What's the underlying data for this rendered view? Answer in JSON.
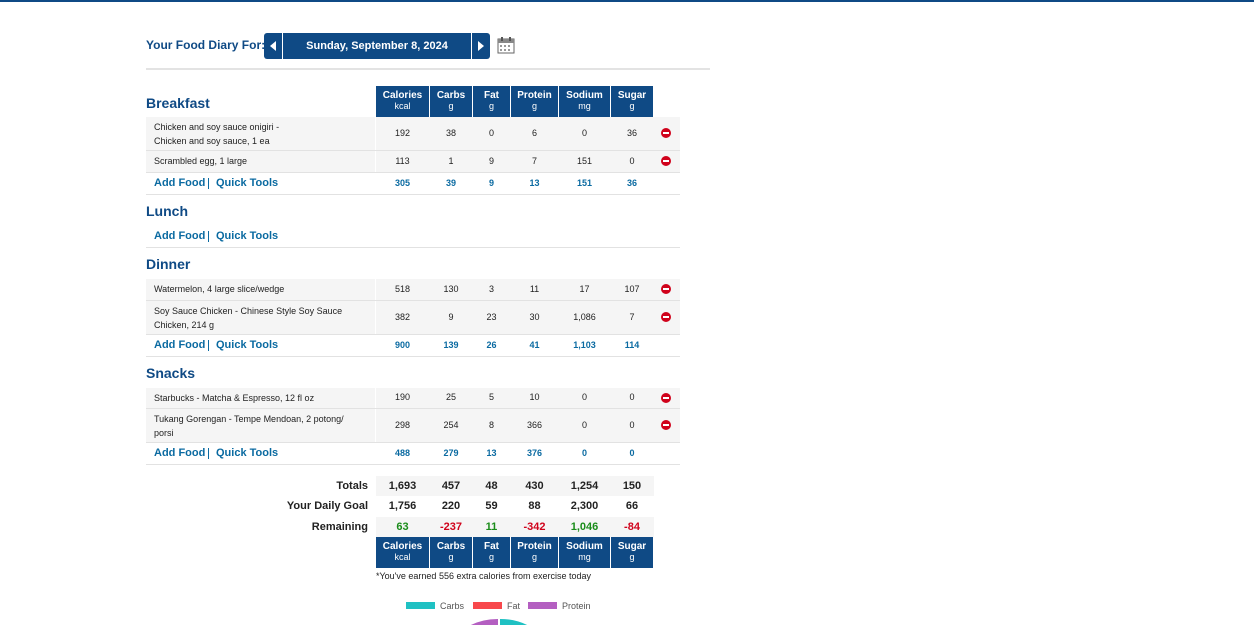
{
  "header": {
    "diary_label": "Your Food Diary For:",
    "date": "Sunday, September 8, 2024"
  },
  "columns": [
    {
      "name": "Calories",
      "unit": "kcal"
    },
    {
      "name": "Carbs",
      "unit": "g"
    },
    {
      "name": "Fat",
      "unit": "g"
    },
    {
      "name": "Protein",
      "unit": "g"
    },
    {
      "name": "Sodium",
      "unit": "mg"
    },
    {
      "name": "Sugar",
      "unit": "g"
    }
  ],
  "links": {
    "add_food": "Add Food",
    "quick_tools": "Quick Tools"
  },
  "meals": {
    "breakfast": {
      "title": "Breakfast",
      "items": [
        {
          "name": "Chicken and soy sauce onigiri - Chicken and soy sauce, 1 ea",
          "values": [
            "192",
            "38",
            "0",
            "6",
            "0",
            "36"
          ]
        },
        {
          "name": "Scrambled egg, 1 large",
          "values": [
            "113",
            "1",
            "9",
            "7",
            "151",
            "0"
          ]
        }
      ],
      "totals": [
        "305",
        "39",
        "9",
        "13",
        "151",
        "36"
      ]
    },
    "lunch": {
      "title": "Lunch"
    },
    "dinner": {
      "title": "Dinner",
      "items": [
        {
          "name": "Watermelon, 4 large slice/wedge",
          "values": [
            "518",
            "130",
            "3",
            "11",
            "17",
            "107"
          ]
        },
        {
          "name": "Soy Sauce Chicken - Chinese Style Soy Sauce Chicken, 214 g",
          "values": [
            "382",
            "9",
            "23",
            "30",
            "1,086",
            "7"
          ]
        }
      ],
      "totals": [
        "900",
        "139",
        "26",
        "41",
        "1,103",
        "114"
      ]
    },
    "snacks": {
      "title": "Snacks",
      "items": [
        {
          "name": "Starbucks - Matcha & Espresso, 12 fl oz",
          "values": [
            "190",
            "25",
            "5",
            "10",
            "0",
            "0"
          ]
        },
        {
          "name": "Tukang Gorengan - Tempe Mendoan, 2 potong/ porsi",
          "values": [
            "298",
            "254",
            "8",
            "366",
            "0",
            "0"
          ]
        }
      ],
      "totals": [
        "488",
        "279",
        "13",
        "376",
        "0",
        "0"
      ]
    }
  },
  "summary": {
    "totals_label": "Totals",
    "totals": [
      "1,693",
      "457",
      "48",
      "430",
      "1,254",
      "150"
    ],
    "goal_label": "Your Daily Goal",
    "goal": [
      "1,756",
      "220",
      "59",
      "88",
      "2,300",
      "66"
    ],
    "remaining_label": "Remaining",
    "remaining": [
      "63",
      "-237",
      "11",
      "-342",
      "1,046",
      "-84"
    ],
    "exercise_note": "*You've earned 556 extra calories from exercise today"
  },
  "legend": [
    {
      "label": "Carbs",
      "color": "#1fc1c3"
    },
    {
      "label": "Fat",
      "color": "#f8484c"
    },
    {
      "label": "Protein",
      "color": "#b45fc1"
    }
  ],
  "colors": {
    "brand": "#0f4a85",
    "link": "#0a6aa1",
    "positive": "#1a8c1a",
    "negative": "#d0021b"
  }
}
